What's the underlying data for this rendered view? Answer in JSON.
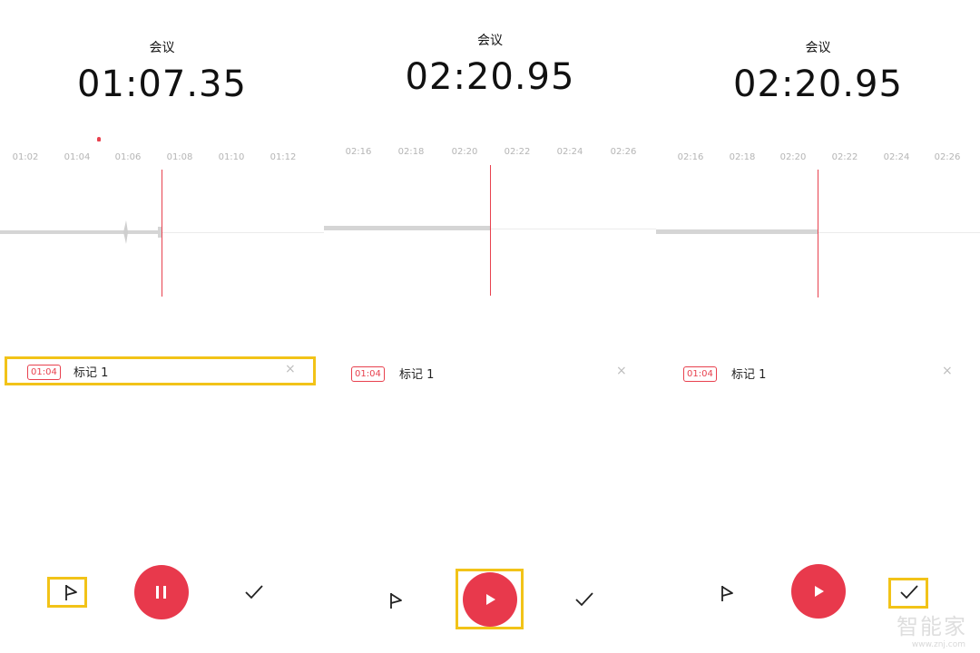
{
  "panels": [
    {
      "title": "会议",
      "time": "01:07.35",
      "ticks": [
        "01:02",
        "01:04",
        "01:06",
        "01:08",
        "01:10",
        "01:12"
      ],
      "state": "recording",
      "mark": {
        "time": "01:04",
        "label": "标记 1",
        "close": "×"
      },
      "highlight": "mark"
    },
    {
      "title": "会议",
      "time": "02:20.95",
      "ticks": [
        "02:16",
        "02:18",
        "02:20",
        "02:22",
        "02:24",
        "02:26"
      ],
      "state": "paused",
      "mark": {
        "time": "01:04",
        "label": "标记 1",
        "close": "×"
      },
      "highlight": "play"
    },
    {
      "title": "会议",
      "time": "02:20.95",
      "ticks": [
        "02:16",
        "02:18",
        "02:20",
        "02:22",
        "02:24",
        "02:26"
      ],
      "state": "paused",
      "mark": {
        "time": "01:04",
        "label": "标记 1",
        "close": "×"
      },
      "highlight": "done"
    }
  ],
  "icons": {
    "flag": "flag-icon",
    "pause": "pause-icon",
    "play": "play-icon",
    "done": "check-icon"
  },
  "colors": {
    "accent": "#e8394c",
    "highlight": "#f2c318",
    "waveform": "#d5d5d5"
  },
  "watermark": {
    "text": "智能家",
    "url": "www.znj.com"
  }
}
